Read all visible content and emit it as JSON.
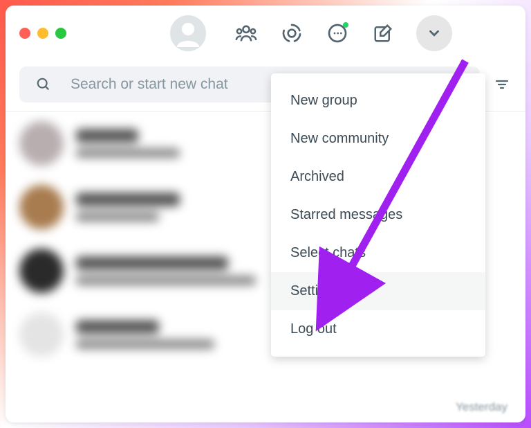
{
  "search": {
    "placeholder": "Search or start new chat"
  },
  "menu": {
    "items": [
      {
        "label": "New group"
      },
      {
        "label": "New community"
      },
      {
        "label": "Archived"
      },
      {
        "label": "Starred messages"
      },
      {
        "label": "Select chats"
      },
      {
        "label": "Settings"
      },
      {
        "label": "Log out"
      }
    ]
  },
  "timestamp": "Yesterday"
}
